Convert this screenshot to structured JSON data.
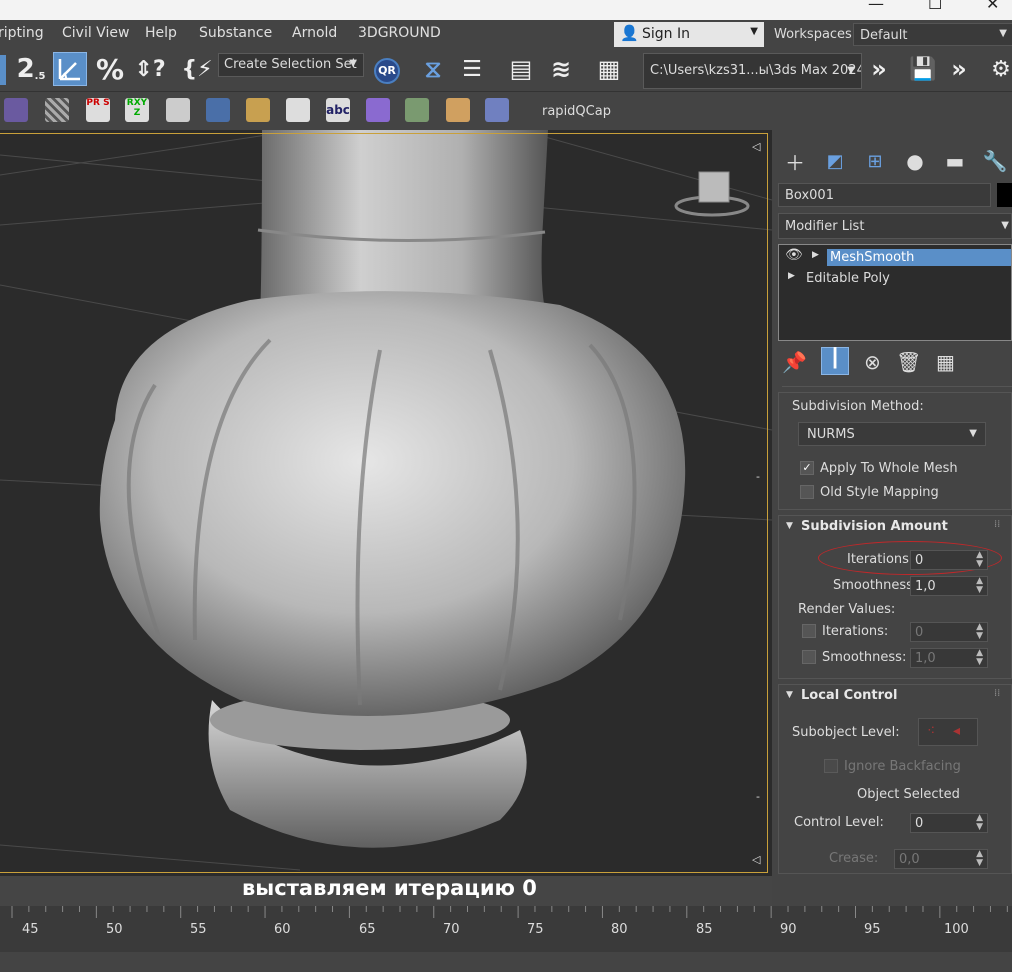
{
  "menu": [
    "ripting",
    "Civil View",
    "Help",
    "Substance",
    "Arnold",
    "3DGROUND"
  ],
  "signin": {
    "label": "Sign In"
  },
  "workspaces": {
    "label": "Workspaces:",
    "value": "Default"
  },
  "toolbar": {
    "snap2_label": "2",
    "snap2_sub": ".5",
    "percent": "%",
    "selection_set": "Create Selection Set",
    "qr_label": "QR",
    "path": "C:\\Users\\kzs31...ы\\3ds Max 2024",
    "rapidqcap": "rapidQCap",
    "abc": "abc"
  },
  "viewport": {
    "caption": "выставляем итерацию 0"
  },
  "command_panel": {
    "object_name": "Box001",
    "modifier_list": "Modifier List",
    "stack": [
      "MeshSmooth",
      "Editable Poly"
    ],
    "subdivision_method": {
      "label": "Subdivision Method:",
      "value": "NURMS"
    },
    "apply_whole_mesh": "Apply To Whole Mesh",
    "old_style_mapping": "Old Style Mapping",
    "subdivision_amount": {
      "title": "Subdivision Amount",
      "iterations_label": "Iterations:",
      "iterations": "0",
      "smoothness_label": "Smoothness:",
      "smoothness": "1,0",
      "render_values": "Render Values:",
      "r_iterations_label": "Iterations:",
      "r_iterations": "0",
      "r_smoothness_label": "Smoothness:",
      "r_smoothness": "1,0"
    },
    "local_control": {
      "title": "Local Control",
      "subobject_level": "Subobject Level:",
      "ignore_backfacing": "Ignore Backfacing",
      "object_selected": "Object Selected",
      "control_level_label": "Control Level:",
      "control_level": "0",
      "crease_label": "Crease:",
      "crease": "0,0"
    }
  },
  "timeline": {
    "ticks": [
      "45",
      "50",
      "55",
      "60",
      "65",
      "70",
      "75",
      "80",
      "85",
      "90",
      "95",
      "100"
    ]
  },
  "colors": {
    "accent": "#5a8fc8",
    "viewport_border": "#c9a03a",
    "highlight_ellipse": "#c0282a"
  }
}
